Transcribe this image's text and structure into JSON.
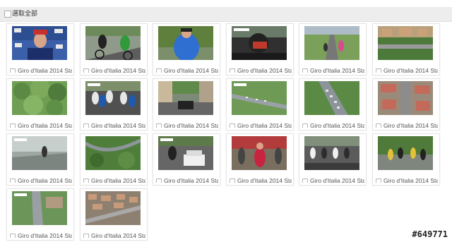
{
  "select_all": {
    "label": "選取全部",
    "checked": false
  },
  "watermark": "#649771",
  "items": [
    {
      "caption": "Giro d'Italia 2014 Sta",
      "checked": false,
      "scene": "podium-interview"
    },
    {
      "caption": "Giro d'Italia 2014 Sta",
      "checked": false,
      "scene": "road-riders"
    },
    {
      "caption": "Giro d'Italia 2014 Sta",
      "checked": false,
      "scene": "rider-closeup"
    },
    {
      "caption": "Giro d'Italia 2014 Sta",
      "checked": false,
      "scene": "motorbike-cam"
    },
    {
      "caption": "Giro d'Italia 2014 Sta",
      "checked": false,
      "scene": "climb-road"
    },
    {
      "caption": "Giro d'Italia 2014 Sta",
      "checked": false,
      "scene": "village-aerial"
    },
    {
      "caption": "Giro d'Italia 2014 Sta",
      "checked": false,
      "scene": "forest"
    },
    {
      "caption": "Giro d'Italia 2014 Sta",
      "checked": false,
      "scene": "peloton"
    },
    {
      "caption": "Giro d'Italia 2014 Sta",
      "checked": false,
      "scene": "town-street"
    },
    {
      "caption": "Giro d'Italia 2014 Sta",
      "checked": false,
      "scene": "aerial-road"
    },
    {
      "caption": "Giro d'Italia 2014 Sta",
      "checked": false,
      "scene": "aerial-peloton"
    },
    {
      "caption": "Giro d'Italia 2014 Sta",
      "checked": false,
      "scene": "aerial-town"
    },
    {
      "caption": "Giro d'Italia 2014 Sta",
      "checked": false,
      "scene": "wet-road"
    },
    {
      "caption": "Giro d'Italia 2014 Sta",
      "checked": false,
      "scene": "mountain-aerial"
    },
    {
      "caption": "Giro d'Italia 2014 Sta",
      "checked": false,
      "scene": "team-car"
    },
    {
      "caption": "Giro d'Italia 2014 Sta",
      "checked": false,
      "scene": "crowd-rider"
    },
    {
      "caption": "Giro d'Italia 2014 Sta",
      "checked": false,
      "scene": "road-group"
    },
    {
      "caption": "Giro d'Italia 2014 Sta",
      "checked": false,
      "scene": "riders-green"
    },
    {
      "caption": "Giro d'Italia 2014 Sta",
      "checked": false,
      "scene": "aerial-road2"
    },
    {
      "caption": "Giro d'Italia 2014 Sta",
      "checked": false,
      "scene": "aerial-city"
    }
  ]
}
